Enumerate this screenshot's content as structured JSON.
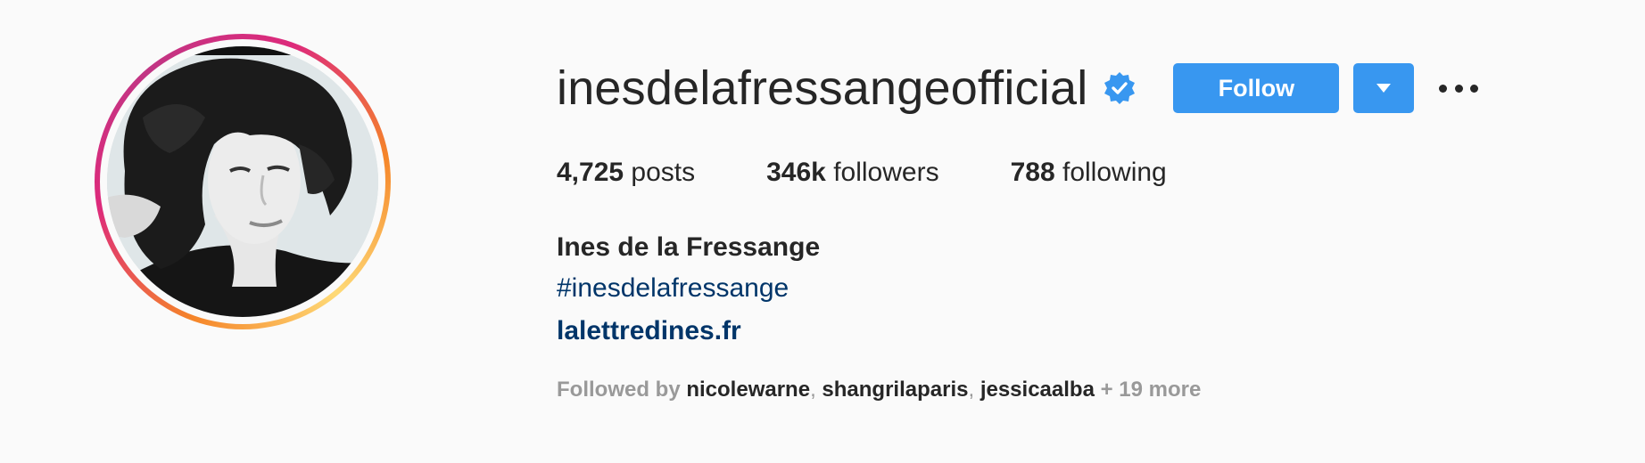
{
  "profile": {
    "username": "inesdelafressangeofficial",
    "verified_icon": "verified-badge-icon",
    "full_name": "Ines de la Fressange",
    "bio_hashtag": "#inesdelafressange",
    "website": "lalettredines.fr",
    "avatar_icon": "profile-photo"
  },
  "actions": {
    "follow_label": "Follow",
    "dropdown_icon": "caret-down-icon",
    "more_icon": "ellipsis-icon"
  },
  "stats": {
    "posts_count": "4,725",
    "posts_label": " posts",
    "followers_count": "346k",
    "followers_label": " followers",
    "following_count": "788",
    "following_label": " following"
  },
  "followed_by": {
    "prefix": "Followed by",
    "users": [
      "nicolewarne",
      "shangrilaparis",
      "jessicaalba"
    ],
    "sep": ", ",
    "more": "+ 19 more"
  },
  "colors": {
    "accent": "#3897f0",
    "link": "#003569",
    "text": "#262626",
    "muted": "#999999",
    "background": "#fafafa"
  }
}
